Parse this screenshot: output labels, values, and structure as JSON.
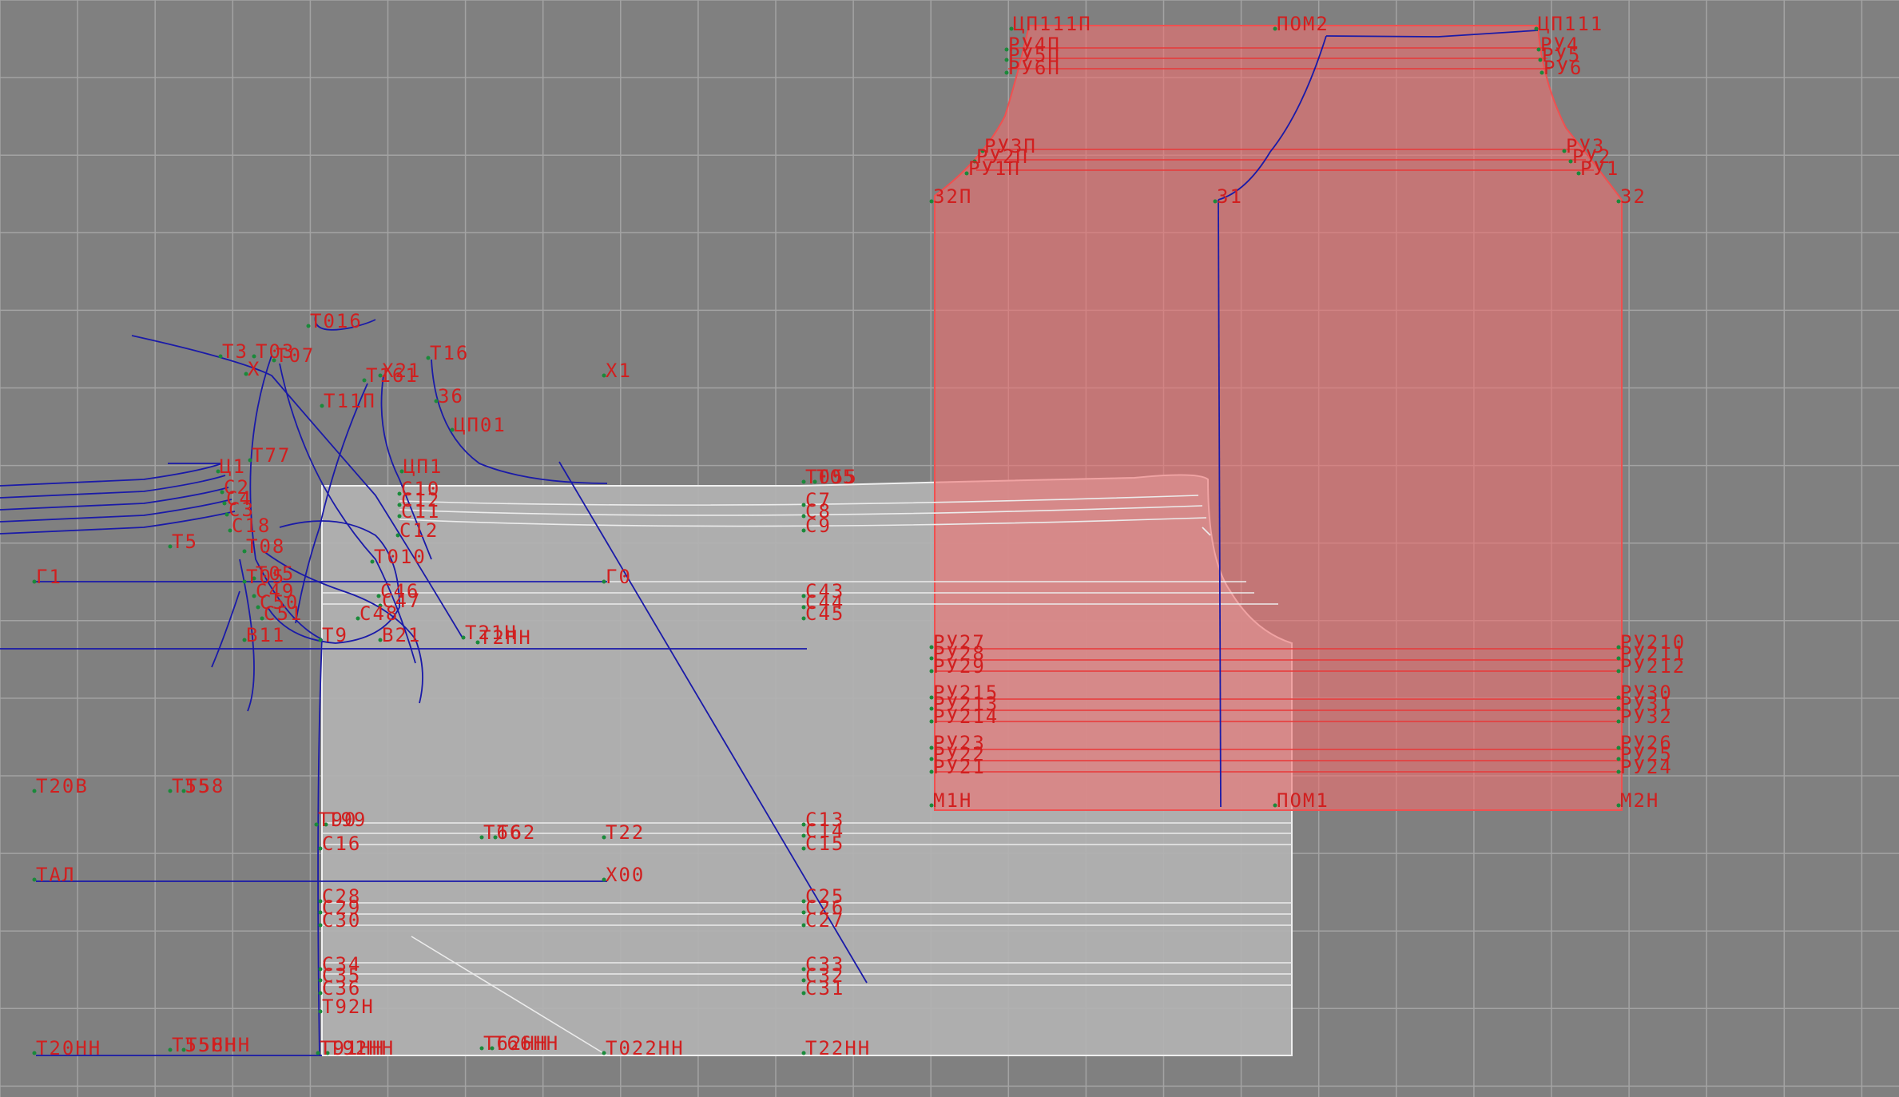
{
  "colors": {
    "background": "#808080",
    "grid": "#a3a3a3",
    "piece_gray": "#b2b2b2",
    "piece_pink": "#f07070",
    "label_red": "#d11f1f",
    "construction_blue": "#1a1aa8",
    "point_green": "#1a8a3a"
  },
  "labels": {
    "cp111p": "ЦП111П",
    "pom2": "ПОМ2",
    "cp111": "ЦП111",
    "ru4p": "РУ4П",
    "ru5p": "РУ5П",
    "ru6p": "РУ6П",
    "ru4": "РУ4",
    "ru5": "РУ5",
    "ru6": "РУ6",
    "ru3p": "РУ3П",
    "ru2p": "РУ2П",
    "ru1p": "РУ1П",
    "ru3": "РУ3",
    "ru2": "РУ2",
    "ru1": "РУ1",
    "p32p": "32П",
    "p31": "31",
    "p32": "32",
    "t016": "Т016",
    "t3": "Т3",
    "t03": "Т03",
    "t07": "Т07",
    "x": "X",
    "t16": "Т16",
    "x21": "Х21",
    "t161": "Т161",
    "t11p": "Т11П",
    "p36": "36",
    "x1": "Х1",
    "cp01": "ЦП01",
    "t77": "Т77",
    "c1": "Ц1",
    "cp1": "ЦП1",
    "t055": "Т055",
    "t05": "Т05",
    "c2": "С2",
    "c4": "С4",
    "c3": "С3",
    "c18": "С18",
    "c10": "С10",
    "c12": "С12",
    "c11": "С11",
    "c12b": "С12",
    "c7": "С7",
    "c8": "С8",
    "c9": "С9",
    "t5": "Т5",
    "t08": "Т08",
    "t010": "Т010",
    "g1": "Г1",
    "g0": "Г0",
    "t05b": "Т05",
    "t05c": "Т05",
    "c49": "С49",
    "c46": "С46",
    "c50": "С50",
    "c47": "С47",
    "c51": "С51",
    "c48": "С48",
    "c43": "С43",
    "c44": "С44",
    "c45": "С45",
    "v11": "В11",
    "t9": "Т9",
    "v21": "В21",
    "t21n": "Т21Н",
    "t2hh": "Т2НН",
    "ru27": "РУ27",
    "ru28": "РУ28",
    "ru29": "РУ29",
    "ru210": "РУ210",
    "ru211": "РУ211",
    "ru212": "РУ212",
    "ru215": "РУ215",
    "ru213": "РУ213",
    "ru214": "РУ214",
    "ru30": "РУ30",
    "ru31": "РУ31",
    "ru32": "РУ32",
    "ru23": "РУ23",
    "ru22": "РУ22",
    "ru21": "РУ21",
    "ru26": "РУ26",
    "ru25": "РУ25",
    "ru24": "РУ24",
    "m1n": "М1Н",
    "pom1": "ПОМ1",
    "m2n": "М2Н",
    "t20v": "Т20В",
    "t55": "Т55",
    "t58": "Т58",
    "t90": "Т90",
    "t99": "Т99",
    "c16": "С16",
    "t66": "Т66",
    "t62": "Т62",
    "t22": "Т22",
    "c13": "С13",
    "c14": "С14",
    "c15": "С15",
    "tal": "ТАЛ",
    "x00": "Х00",
    "c28": "С28",
    "c29": "С29",
    "c30": "С30",
    "c25": "С25",
    "c26": "С26",
    "c27": "С27",
    "c34": "С34",
    "c35": "С35",
    "c36": "С36",
    "c33": "С33",
    "c32": "С32",
    "c31": "С31",
    "t92n": "Т92Н",
    "t20hh": "Т20НН",
    "t55hh": "Т55НН",
    "t58hh": "Т58НН",
    "t91hh": "Т91НН",
    "t92hh": "Т92НН",
    "t62hh": "Т62НН",
    "t66hh": "Т66НН",
    "t022hh": "Т022НН",
    "t22hh": "Т22НН"
  }
}
